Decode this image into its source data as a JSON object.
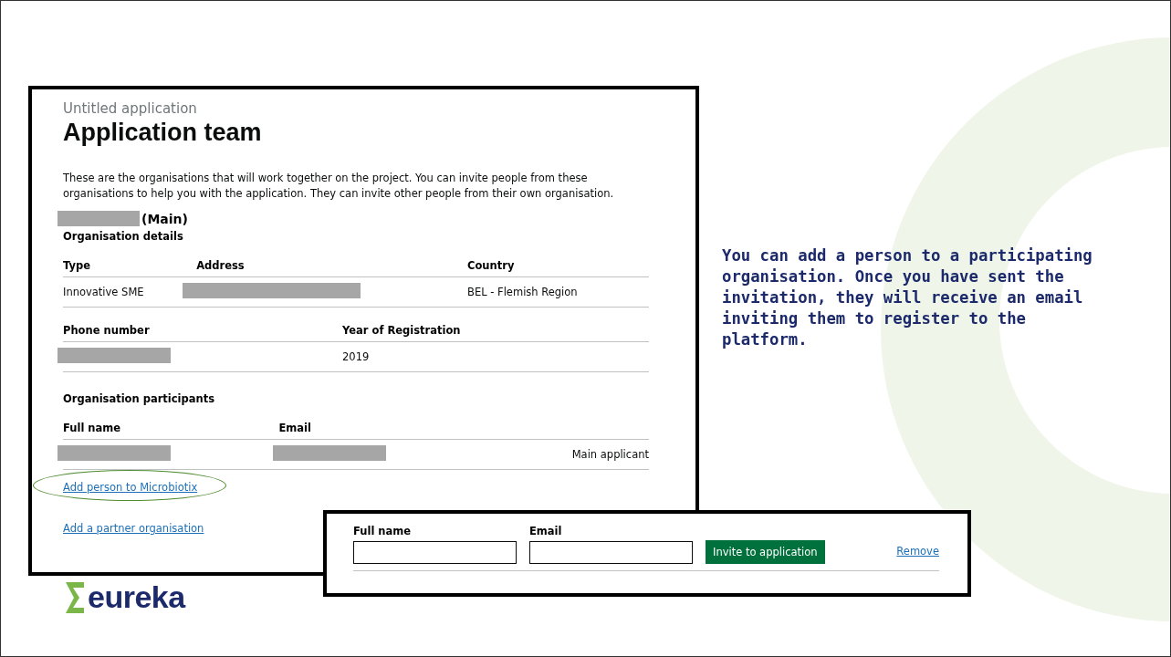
{
  "screenshot": {
    "caption": "Untitled application",
    "title": "Application team",
    "intro": "These are the organisations that will work together on the project. You can invite people from these organisations to help you with the application. They can invite other people from their own organisation.",
    "organisation": {
      "suffix": "(Main)",
      "details_heading": "Organisation details",
      "details_tables": [
        {
          "columns": [
            "Type",
            "Address",
            "Country"
          ],
          "cells": [
            {
              "kind": "text",
              "text": "Innovative SME"
            },
            {
              "kind": "redacted"
            },
            {
              "kind": "text",
              "text": "BEL - Flemish Region"
            }
          ]
        },
        {
          "columns": [
            "Phone number",
            "Year of Registration"
          ],
          "cells": [
            {
              "kind": "redacted"
            },
            {
              "kind": "text",
              "text": "2019"
            }
          ]
        }
      ],
      "participants_heading": "Organisation participants",
      "participants": {
        "columns": [
          "Full name",
          "Email"
        ],
        "rows": [
          {
            "cells": [
              {
                "kind": "redacted"
              },
              {
                "kind": "redacted"
              }
            ],
            "role": "Main applicant"
          }
        ]
      }
    },
    "links": [
      {
        "text": "Add person to Microbiotix",
        "highlighted": true
      },
      {
        "text": "Add a partner organisation",
        "highlighted": false
      }
    ]
  },
  "invite_form": {
    "fields": [
      {
        "label": "Full name"
      },
      {
        "label": "Email"
      }
    ],
    "button": "Invite to application",
    "remove": "Remove"
  },
  "callout": "You can add a person to a participating organisation. Once you have sent the invitation, they will receive an email inviting them to register to the platform.",
  "logo": {
    "text": "eureka"
  }
}
